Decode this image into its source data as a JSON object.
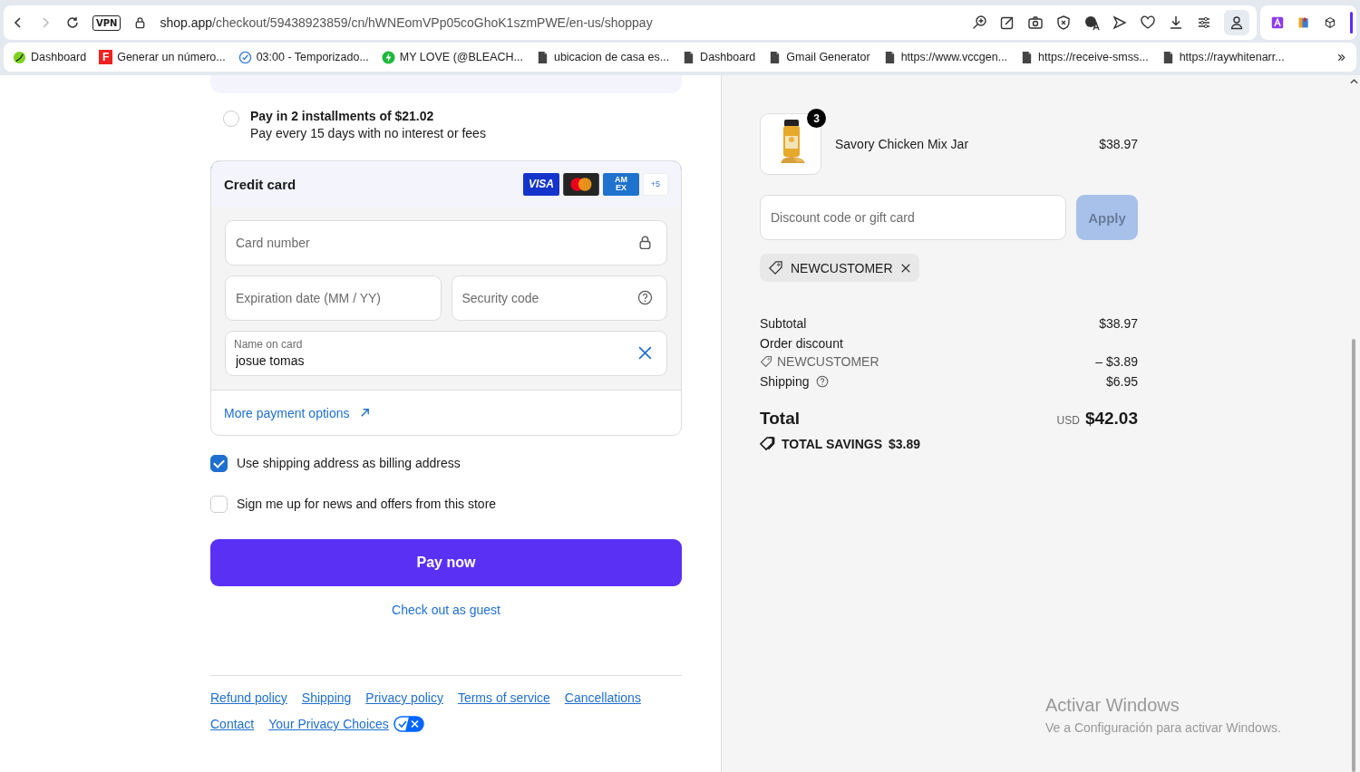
{
  "browser": {
    "vpn": "VPN",
    "url_domain": "shop.app",
    "url_path": "/checkout/59438923859/cn/hWNEomVPp05coGhoK1szmPWE/en-us/shoppay",
    "bookmarks": [
      {
        "label": "Dashboard",
        "kind": "leaf"
      },
      {
        "label": "Generar un número...",
        "kind": "f"
      },
      {
        "label": "03:00 - Temporizado...",
        "kind": "timer"
      },
      {
        "label": "MY LOVE (@BLEACH...",
        "kind": "bolt"
      },
      {
        "label": "ubicacion de casa es...",
        "kind": "page"
      },
      {
        "label": "Dashboard",
        "kind": "page"
      },
      {
        "label": "Gmail Generator",
        "kind": "page"
      },
      {
        "label": "https://www.vccgen...",
        "kind": "page"
      },
      {
        "label": "https://receive-smss...",
        "kind": "page"
      },
      {
        "label": "https://raywhitenarr...",
        "kind": "page"
      }
    ],
    "bookmark_f": "F"
  },
  "payment_options": [
    {
      "title": "Pay in 2 installments of $21.02",
      "subtitle": "Pay every 15 days with no interest or fees",
      "selected": false
    }
  ],
  "credit_card": {
    "title": "Credit card",
    "brands": [
      {
        "kind": "visa",
        "label": "VISA"
      },
      {
        "kind": "mastercard"
      },
      {
        "kind": "amex",
        "label": "AM EX"
      }
    ],
    "more_brands": "+5",
    "card_number": {
      "placeholder": "Card number"
    },
    "expiration": {
      "placeholder": "Expiration date (MM / YY)"
    },
    "security_code": {
      "placeholder": "Security code"
    },
    "name_on_card": {
      "label": "Name on card",
      "value": "josue tomas"
    },
    "more_link": "More payment options"
  },
  "checkboxes": [
    {
      "label": "Use shipping address as billing address",
      "checked": true
    },
    {
      "label": "Sign me up for news and offers from this store",
      "checked": false
    }
  ],
  "pay_button": "Pay now",
  "guest_link": "Check out as guest",
  "footer_links": [
    {
      "label": "Refund policy"
    },
    {
      "label": "Shipping"
    },
    {
      "label": "Privacy policy"
    },
    {
      "label": "Terms of service"
    },
    {
      "label": "Cancellations"
    },
    {
      "label": "Contact"
    },
    {
      "label": "Your Privacy Choices",
      "privacy_toggle": true
    }
  ],
  "summary": {
    "items": [
      {
        "name": "Savory Chicken Mix Jar",
        "price": "$38.97",
        "quantity": "3"
      }
    ],
    "discount": {
      "placeholder": "Discount code or gift card",
      "button": "Apply",
      "disabled": true
    },
    "applied_codes": [
      {
        "code": "NEWCUSTOMER"
      }
    ],
    "subtotal": {
      "label": "Subtotal",
      "value": "$38.97"
    },
    "order_discount": {
      "label": "Order discount",
      "code": "NEWCUSTOMER",
      "value": "– $3.89"
    },
    "shipping": {
      "label": "Shipping",
      "value": "$6.95"
    },
    "total": {
      "label": "Total",
      "currency": "USD",
      "amount": "$42.03"
    },
    "savings": {
      "label": "TOTAL SAVINGS",
      "amount": "$3.89"
    }
  },
  "windows_notice": {
    "title": "Activar Windows",
    "subtitle": "Ve a Configuración para activar Windows."
  }
}
